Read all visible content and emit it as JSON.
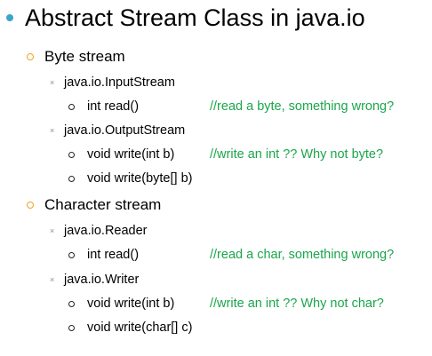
{
  "title": "Abstract Stream Class in java.io",
  "sections": [
    {
      "label": "Byte stream",
      "classes": [
        {
          "name": "java.io.InputStream",
          "methods": [
            {
              "signature": "int read()",
              "comment": "//read a byte, something wrong?"
            }
          ]
        },
        {
          "name": "java.io.OutputStream",
          "methods": [
            {
              "signature": "void write(int b)",
              "comment": "//write an int ?? Why not byte?"
            },
            {
              "signature": "void write(byte[] b)",
              "comment": ""
            }
          ]
        }
      ]
    },
    {
      "label": "Character stream",
      "classes": [
        {
          "name": "java.io.Reader",
          "methods": [
            {
              "signature": "int read()",
              "comment": "//read a char, something wrong?"
            }
          ]
        },
        {
          "name": "java.io.Writer",
          "methods": [
            {
              "signature": "void write(int b)",
              "comment": "//write an int ?? Why not char?"
            },
            {
              "signature": "void write(char[] c)",
              "comment": ""
            }
          ]
        }
      ]
    }
  ],
  "colors": {
    "title_bullet": "#3aa6c9",
    "section_bullet": "#f0a21b",
    "class_bullet": "#8c8c8c",
    "comment": "#1aa64a"
  },
  "icons": {
    "title_bullet": "filled-circle-icon",
    "section_bullet": "hollow-circle-icon",
    "class_bullet": "x-mark-icon",
    "method_bullet": "hollow-circle-icon"
  }
}
